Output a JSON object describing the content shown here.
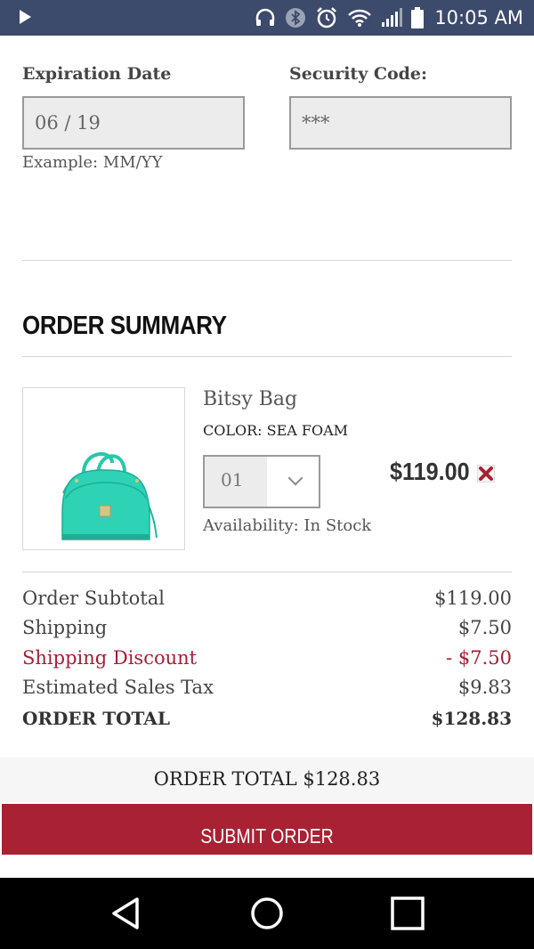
{
  "status_bar": {
    "time": "10:05 AM",
    "icons": [
      "play-icon",
      "headset-icon",
      "bluetooth-icon",
      "alarm-icon",
      "wifi-icon",
      "signal-icon",
      "battery-icon"
    ]
  },
  "payment": {
    "expiration_label": "Expiration Date",
    "expiration_value": "06 / 19",
    "expiration_hint": "Example: MM/YY",
    "security_label": "Security Code:",
    "security_value": "***"
  },
  "order_summary": {
    "title": "ORDER SUMMARY",
    "item": {
      "name": "Bitsy Bag",
      "color": "COLOR: SEA FOAM",
      "quantity": "01",
      "availability": "Availability: In Stock",
      "price": "$119.00",
      "bag_color": "#2dd3b4"
    },
    "totals": [
      {
        "label": "Order Subtotal",
        "value": "$119.00"
      },
      {
        "label": "Shipping",
        "value": "$7.50"
      },
      {
        "label": "Shipping Discount",
        "value": "- $7.50"
      },
      {
        "label": "Estimated Sales Tax",
        "value": "$9.83"
      },
      {
        "label": "ORDER TOTAL",
        "value": "$128.83"
      }
    ]
  },
  "footer": {
    "order_total_text": "ORDER TOTAL $128.83",
    "submit_label": "SUBMIT ORDER"
  },
  "colors": {
    "accent": "#a82234",
    "status_bar": "#3c4a6b"
  }
}
